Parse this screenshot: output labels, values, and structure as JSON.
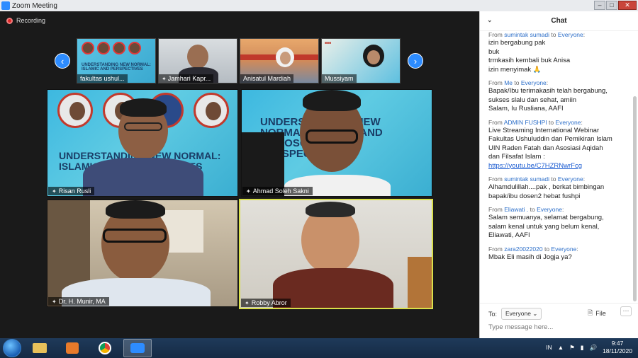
{
  "window": {
    "title": "Zoom Meeting"
  },
  "recording": {
    "label": "Recording"
  },
  "thumbnails": [
    {
      "name": "fakultas ushul..."
    },
    {
      "name": "Jamhari Kapr..."
    },
    {
      "name": "Anisatul Mardiah"
    },
    {
      "name": "Mussiyam"
    }
  ],
  "tiles": [
    {
      "name": "Risan Rusli"
    },
    {
      "name": "Ahmad Soleh Sakni"
    },
    {
      "name": "Dr. H. Munir, MA"
    },
    {
      "name": "Robby Abror"
    }
  ],
  "slide": {
    "title_left": "UNDERSTANDING NEW NORMAL: ISLAMIC AND PERSPECTIVES",
    "title_right": "UNDERSTANDING NEW NORMAL: ISLAMIC AND PHILOSOPHICAL PERSPECTIVE"
  },
  "chat": {
    "title": "Chat",
    "messages": [
      {
        "from": "sumintak sumadi",
        "to": "Everyone",
        "lines": [
          "izin bergabung  pak",
          "buk",
          "trmkasih kembali buk Anisa",
          "izin menyimak 🙏"
        ]
      },
      {
        "from": "Me",
        "to": "Everyone",
        "lines": [
          "Bapak/Ibu terimakasih telah bergabung,",
          "sukses slalu dan sehat, amiin",
          "Salam, Iu Rusliana, AAFI"
        ]
      },
      {
        "from": "ADMIN FUSHPI",
        "to": "Everyone",
        "lines": [
          "Live Streaming International Webinar",
          "Fakultas Ushuluddin dan Pemikiran Islam",
          "UIN Raden Fatah dan Asosiasi Aqidah",
          "dan Filsafat Islam :"
        ],
        "link": "https://youtu.be/C7HZRNwrFcg"
      },
      {
        "from": "sumintak sumadi",
        "to": "Everyone",
        "lines": [
          "Alhamdulillah....pak , berkat bimbingan",
          "bapak/ibu  dosen2 hebat fushpi"
        ]
      },
      {
        "from": "Eliawati .",
        "to": "Everyone",
        "lines": [
          "Salam semuanya, selamat bergabung,",
          "salam kenal untuk yang belum kenal,",
          "Eliawati, AAFI"
        ]
      },
      {
        "from": "zara20022020",
        "to": "Everyone",
        "lines": [
          "Mbak Eli masih di Jogja ya?"
        ]
      }
    ],
    "from_label": "From",
    "to_label": "to",
    "recipient_label": "To:",
    "recipient_value": "Everyone",
    "file_label": "File",
    "input_placeholder": "Type message here..."
  },
  "taskbar": {
    "language": "IN",
    "time": "9:47",
    "date": "18/11/2020"
  },
  "colors": {
    "accent": "#2d8cff",
    "active_speaker": "#d9e04a",
    "slide_bg": "#3db8e0"
  }
}
